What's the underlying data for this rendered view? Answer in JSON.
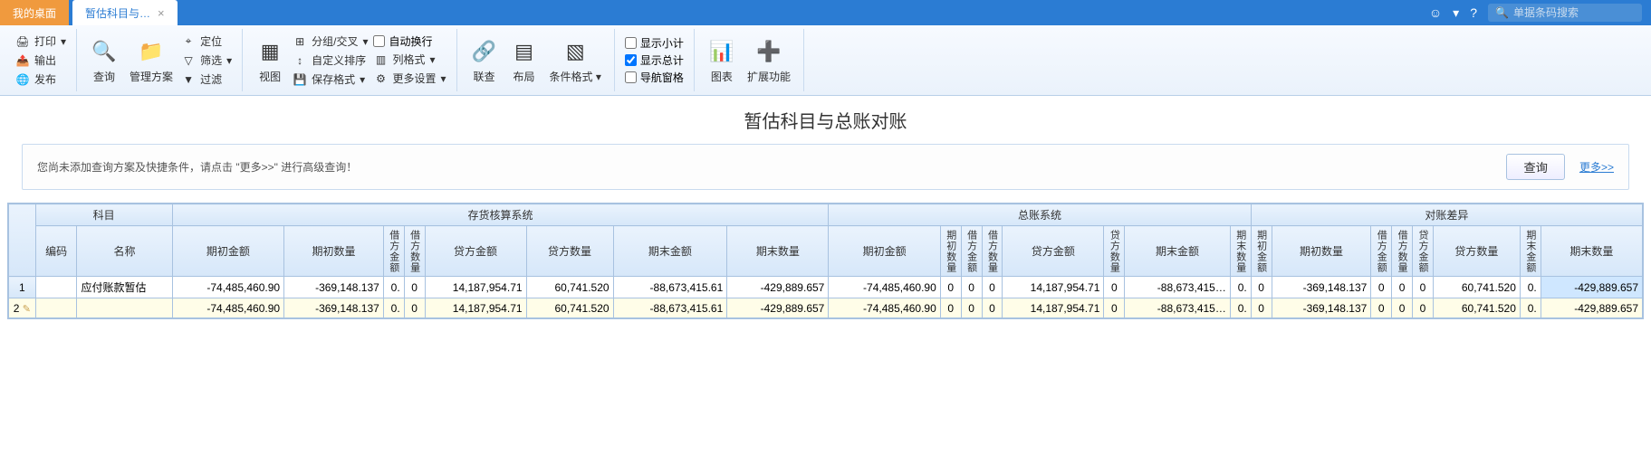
{
  "topbar": {
    "tab_home": "我的桌面",
    "tab_active": "暂估科目与…",
    "search_placeholder": "单据条码搜索"
  },
  "ribbon": {
    "g1": {
      "print": "打印",
      "export": "输出",
      "publish": "发布"
    },
    "g2": {
      "query": "查询",
      "plan": "管理方案",
      "locate": "定位",
      "filter": "筛选",
      "filter2": "过滤"
    },
    "g3": {
      "view": "视图",
      "group": "分组/交叉",
      "sort": "自定义排序",
      "saveFmt": "保存格式",
      "autoWrap": "自动换行",
      "colFmt": "列格式",
      "moreSet": "更多设置"
    },
    "g4": {
      "link": "联查",
      "layout": "布局",
      "condFmt": "条件格式"
    },
    "g5": {
      "subtotal": "显示小计",
      "total": "显示总计",
      "navpane": "导航窗格"
    },
    "g6": {
      "chart": "图表",
      "ext": "扩展功能"
    }
  },
  "title": "暂估科目与总账对账",
  "filter": {
    "text": "您尚未添加查询方案及快捷条件，请点击 \"更多>>\" 进行高级查询！",
    "btn": "查询",
    "more": "更多>>"
  },
  "headers": {
    "subject": "科目",
    "inv": "存货核算系统",
    "gl": "总账系统",
    "diff": "对账差异",
    "code": "编码",
    "name": "名称",
    "begAmt": "期初金额",
    "begQty": "期初数量",
    "drAmt": "借方金额",
    "drQty": "借方数量",
    "crAmt": "贷方金额",
    "crQty": "贷方数量",
    "endAmt": "期末金额",
    "endQty": "期末数量"
  },
  "rows": [
    {
      "no": "1",
      "name": "应付账款暂估",
      "inv_begAmt": "-74,485,460.90",
      "inv_begQty": "-369,148.137",
      "inv_drAmt": "0.",
      "inv_drQty": "0",
      "inv_crAmt": "14,187,954.71",
      "inv_crQty": "60,741.520",
      "inv_endAmt": "-88,673,415.61",
      "inv_endQty": "-429,889.657",
      "gl_begAmt": "-74,485,460.90",
      "gl_begQty": "0",
      "gl_drAmt": "0",
      "gl_drQty": "0",
      "gl_crAmt": "14,187,954.71",
      "gl_crQty": "0",
      "gl_endAmt": "-88,673,415…",
      "gl_endQty": "0.",
      "d_begAmt": "0",
      "d_begQty": "-369,148.137",
      "d_drAmt": "0",
      "d_drQty": "0",
      "d_du": "0",
      "d_crQty": "60,741.520",
      "d_endAmt": "0.",
      "d_endQty": "-429,889.657"
    },
    {
      "no": "2",
      "name": "",
      "inv_begAmt": "-74,485,460.90",
      "inv_begQty": "-369,148.137",
      "inv_drAmt": "0.",
      "inv_drQty": "0",
      "inv_crAmt": "14,187,954.71",
      "inv_crQty": "60,741.520",
      "inv_endAmt": "-88,673,415.61",
      "inv_endQty": "-429,889.657",
      "gl_begAmt": "-74,485,460.90",
      "gl_begQty": "0",
      "gl_drAmt": "0",
      "gl_drQty": "0",
      "gl_crAmt": "14,187,954.71",
      "gl_crQty": "0",
      "gl_endAmt": "-88,673,415…",
      "gl_endQty": "0.",
      "d_begAmt": "0",
      "d_begQty": "-369,148.137",
      "d_drAmt": "0",
      "d_drQty": "0",
      "d_du": "0",
      "d_crQty": "60,741.520",
      "d_endAmt": "0.",
      "d_endQty": "-429,889.657"
    }
  ]
}
